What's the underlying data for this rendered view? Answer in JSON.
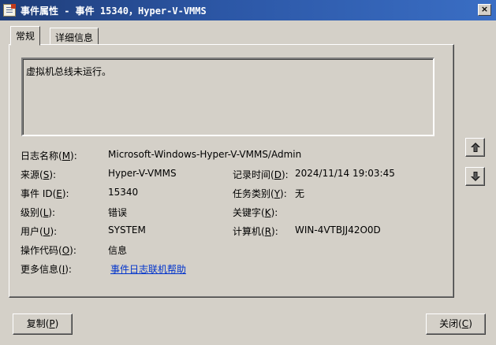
{
  "window": {
    "title": "事件属性 - 事件 15340，Hyper-V-VMMS",
    "close_glyph": "×"
  },
  "tabs": [
    {
      "label": "常规",
      "active": true
    },
    {
      "label": "详细信息",
      "active": false
    }
  ],
  "description": "虚拟机总线未运行。",
  "fields": {
    "log_name": {
      "label": "日志名称(",
      "key": "M",
      "suffix": "):",
      "value": "Microsoft-Windows-Hyper-V-VMMS/Admin"
    },
    "source": {
      "label": "来源(",
      "key": "S",
      "suffix": "):",
      "value": "Hyper-V-VMMS"
    },
    "logged": {
      "label": "记录时间(",
      "key": "D",
      "suffix": "):",
      "value": "2024/11/14 19:03:45"
    },
    "event_id": {
      "label": "事件 ID(",
      "key": "E",
      "suffix": "):",
      "value": "15340"
    },
    "task": {
      "label": "任务类别(",
      "key": "Y",
      "suffix": "):",
      "value": "无"
    },
    "level": {
      "label": "级别(",
      "key": "L",
      "suffix": "):",
      "value": "错误"
    },
    "keywords": {
      "label": "关键字(",
      "key": "K",
      "suffix": "):",
      "value": ""
    },
    "user": {
      "label": "用户(",
      "key": "U",
      "suffix": "):",
      "value": "SYSTEM"
    },
    "computer": {
      "label": "计算机(",
      "key": "R",
      "suffix": "):",
      "value": "WIN-4VTBJJ42O0D"
    },
    "opcode": {
      "label": "操作代码(",
      "key": "O",
      "suffix": "):",
      "value": "信息"
    },
    "more_info": {
      "label": "更多信息(",
      "key": "I",
      "suffix": "):",
      "value": "事件日志联机帮助"
    }
  },
  "buttons": {
    "copy": {
      "label": "复制(",
      "key": "P",
      "suffix": ")"
    },
    "close": {
      "label": "关闭(",
      "key": "C",
      "suffix": ")"
    }
  },
  "icons": {
    "up": "arrow-up-icon",
    "down": "arrow-down-icon"
  }
}
